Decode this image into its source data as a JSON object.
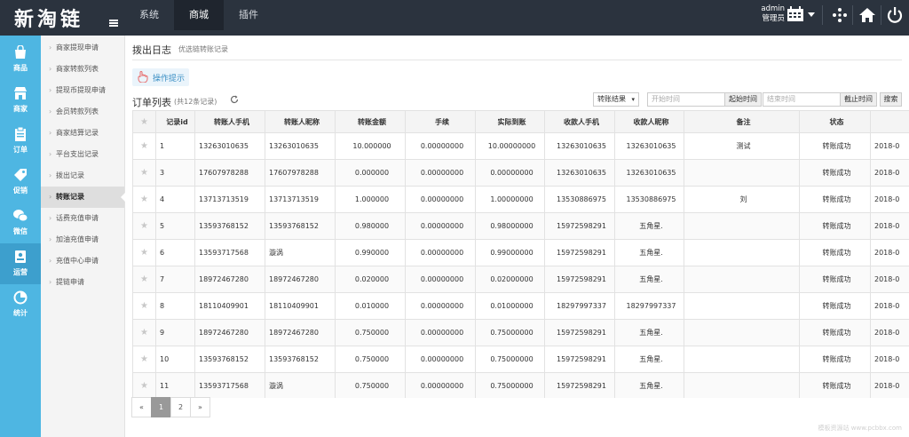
{
  "app": {
    "logo": "新淘链"
  },
  "topnav": [
    {
      "label": "系统",
      "active": false
    },
    {
      "label": "商城",
      "active": true
    },
    {
      "label": "插件",
      "active": false
    }
  ],
  "user": {
    "name": "admin",
    "role": "管理员"
  },
  "colors": {
    "topbar": "#2b333e",
    "sidebar": "#4eb6e2",
    "sidebar_active": "#3d9fcd",
    "accent": "#3b8fc4"
  },
  "sidebar": [
    {
      "label": "商品",
      "icon": "bag-icon",
      "active": false
    },
    {
      "label": "商家",
      "icon": "shop-icon",
      "active": false
    },
    {
      "label": "订单",
      "icon": "clipboard-icon",
      "active": false
    },
    {
      "label": "促销",
      "icon": "tag-icon",
      "active": false
    },
    {
      "label": "微信",
      "icon": "wechat-icon",
      "active": false
    },
    {
      "label": "运营",
      "icon": "operation-icon",
      "active": true
    },
    {
      "label": "统计",
      "icon": "chart-icon",
      "active": false
    }
  ],
  "submenu": [
    {
      "label": "商家提现申请",
      "active": false
    },
    {
      "label": "商家转款列表",
      "active": false
    },
    {
      "label": "提现币提现申请",
      "active": false
    },
    {
      "label": "会员转款列表",
      "active": false
    },
    {
      "label": "商家结算记录",
      "active": false
    },
    {
      "label": "平台支出记录",
      "active": false
    },
    {
      "label": "拨出记录",
      "active": false
    },
    {
      "label": "转账记录",
      "active": true
    },
    {
      "label": "话费充值申请",
      "active": false
    },
    {
      "label": "加油充值申请",
      "active": false
    },
    {
      "label": "充值中心申请",
      "active": false
    },
    {
      "label": "提链申请",
      "active": false
    }
  ],
  "page": {
    "title": "拨出日志",
    "subtitle": "优选链转账记录",
    "tip_button": "操作提示"
  },
  "list": {
    "title": "订单列表",
    "count": "(共12条记录)"
  },
  "filters": {
    "status_select": "转账结果",
    "start_placeholder": "开始时间",
    "start_button": "起始时间",
    "end_placeholder": "结束时间",
    "end_button": "截止时间",
    "search_button": "搜索"
  },
  "table": {
    "columns": [
      "记录id",
      "转账人手机",
      "转账人昵称",
      "转账金额",
      "手续",
      "实际到账",
      "收款人手机",
      "收款人昵称",
      "备注",
      "状态",
      ""
    ],
    "rows": [
      [
        "1",
        "13263010635",
        "13263010635",
        "10.000000",
        "0.00000000",
        "10.00000000",
        "13263010635",
        "13263010635",
        "测试",
        "转账成功",
        "2018-0"
      ],
      [
        "3",
        "17607978288",
        "17607978288",
        "0.000000",
        "0.00000000",
        "0.00000000",
        "13263010635",
        "13263010635",
        "",
        "转账成功",
        "2018-0"
      ],
      [
        "4",
        "13713713519",
        "13713713519",
        "1.000000",
        "0.00000000",
        "1.00000000",
        "13530886975",
        "13530886975",
        "刘",
        "转账成功",
        "2018-0"
      ],
      [
        "5",
        "13593768152",
        "13593768152",
        "0.980000",
        "0.00000000",
        "0.98000000",
        "15972598291",
        "五角星.",
        "",
        "转账成功",
        "2018-0"
      ],
      [
        "6",
        "13593717568",
        "漩涡",
        "0.990000",
        "0.00000000",
        "0.99000000",
        "15972598291",
        "五角星.",
        "",
        "转账成功",
        "2018-0"
      ],
      [
        "7",
        "18972467280",
        "18972467280",
        "0.020000",
        "0.00000000",
        "0.02000000",
        "15972598291",
        "五角星.",
        "",
        "转账成功",
        "2018-0"
      ],
      [
        "8",
        "18110409901",
        "18110409901",
        "0.010000",
        "0.00000000",
        "0.01000000",
        "18297997337",
        "18297997337",
        "",
        "转账成功",
        "2018-0"
      ],
      [
        "9",
        "18972467280",
        "18972467280",
        "0.750000",
        "0.00000000",
        "0.75000000",
        "15972598291",
        "五角星.",
        "",
        "转账成功",
        "2018-0"
      ],
      [
        "10",
        "13593768152",
        "13593768152",
        "0.750000",
        "0.00000000",
        "0.75000000",
        "15972598291",
        "五角星.",
        "",
        "转账成功",
        "2018-0"
      ],
      [
        "11",
        "13593717568",
        "漩涡",
        "0.750000",
        "0.00000000",
        "0.75000000",
        "15972598291",
        "五角星.",
        "",
        "转账成功",
        "2018-0"
      ]
    ]
  },
  "pager": {
    "prev": "«",
    "pages": [
      "1",
      "2"
    ],
    "current": "1",
    "next": "»"
  },
  "watermark": "模板资源站 www.pcbbx.com"
}
